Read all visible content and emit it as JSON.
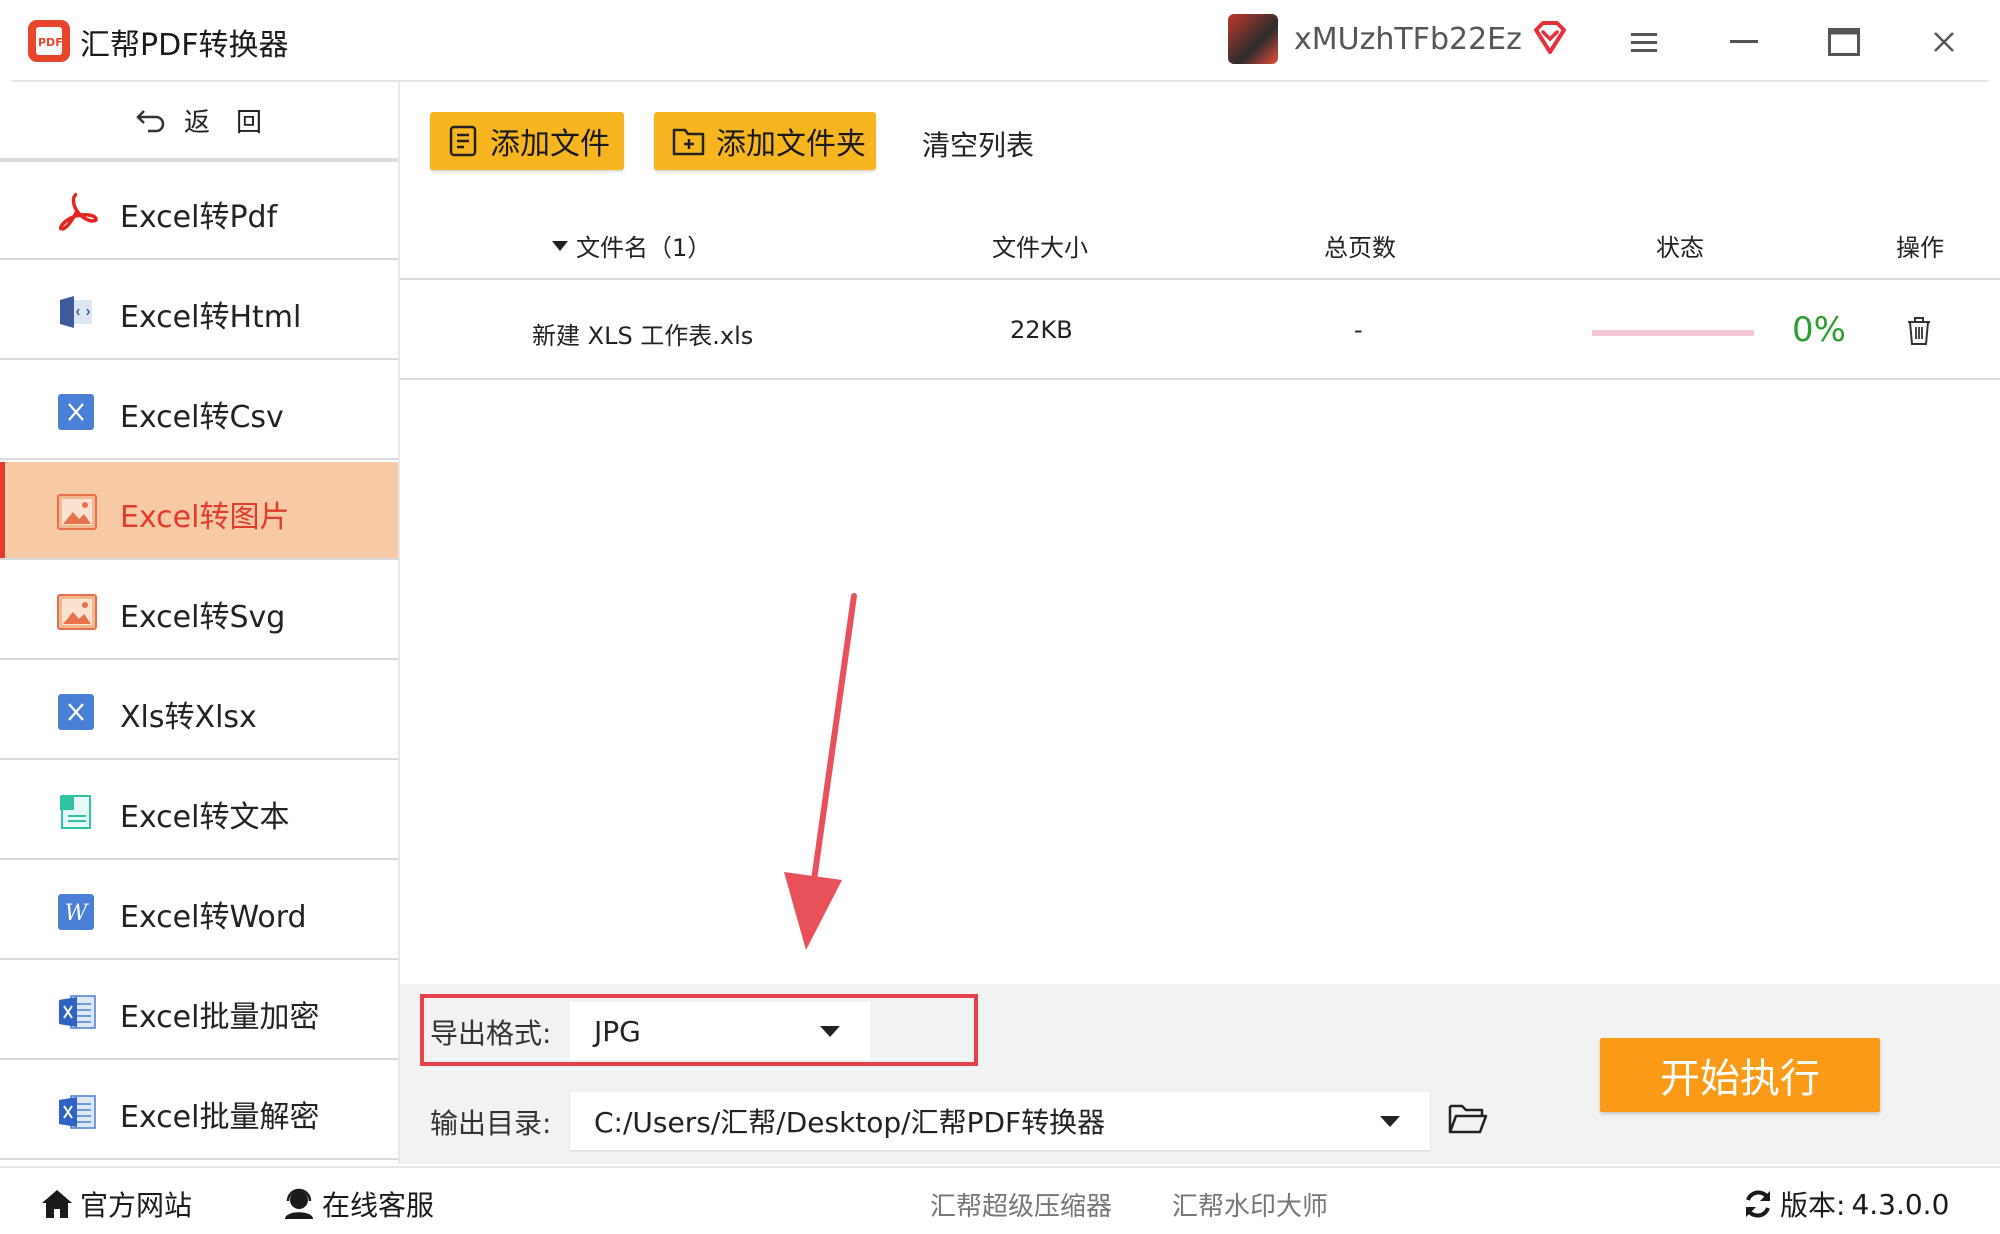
{
  "app": {
    "title": "汇帮PDF转换器",
    "logo_text": "PDF",
    "username": "xMUzhTFb22Ez"
  },
  "sidebar": {
    "back_label": "返　回",
    "items": [
      {
        "label": "Excel转Pdf",
        "icon": "pdf-icon",
        "active": false
      },
      {
        "label": "Excel转Html",
        "icon": "html-icon",
        "active": false
      },
      {
        "label": "Excel转Csv",
        "icon": "csv-icon",
        "active": false
      },
      {
        "label": "Excel转图片",
        "icon": "image-icon",
        "active": true
      },
      {
        "label": "Excel转Svg",
        "icon": "svg-icon",
        "active": false
      },
      {
        "label": "Xls转Xlsx",
        "icon": "xlsx-icon",
        "active": false
      },
      {
        "label": "Excel转文本",
        "icon": "text-icon",
        "active": false
      },
      {
        "label": "Excel转Word",
        "icon": "word-icon",
        "active": false
      },
      {
        "label": "Excel批量加密",
        "icon": "encrypt-icon",
        "active": false
      },
      {
        "label": "Excel批量解密",
        "icon": "decrypt-icon",
        "active": false
      }
    ]
  },
  "toolbar": {
    "add_file": "添加文件",
    "add_folder": "添加文件夹",
    "clear_list": "清空列表"
  },
  "table": {
    "headers": {
      "filename": "文件名（1）",
      "size": "文件大小",
      "pages": "总页数",
      "status": "状态",
      "action": "操作"
    },
    "rows": [
      {
        "filename": "新建 XLS 工作表.xls",
        "size": "22KB",
        "pages": "-",
        "progress_text": "0%",
        "progress": 0
      }
    ]
  },
  "settings": {
    "format_label": "导出格式:",
    "format_value": "JPG",
    "output_label": "输出目录:",
    "output_value": "C:/Users/汇帮/Desktop/汇帮PDF转换器",
    "start_button": "开始执行"
  },
  "footer": {
    "website": "官方网站",
    "support": "在线客服",
    "compressor": "汇帮超级压缩器",
    "watermark": "汇帮水印大师",
    "version_label": "版本:",
    "version_value": "4.3.0.0"
  },
  "colors": {
    "accent_orange": "#f7b61f",
    "start_orange": "#fa9a16",
    "active_bg": "#f7c9a4",
    "active_red": "#e33b2e",
    "progress_green": "#2e9e34",
    "annotation_red": "#e8404a"
  }
}
